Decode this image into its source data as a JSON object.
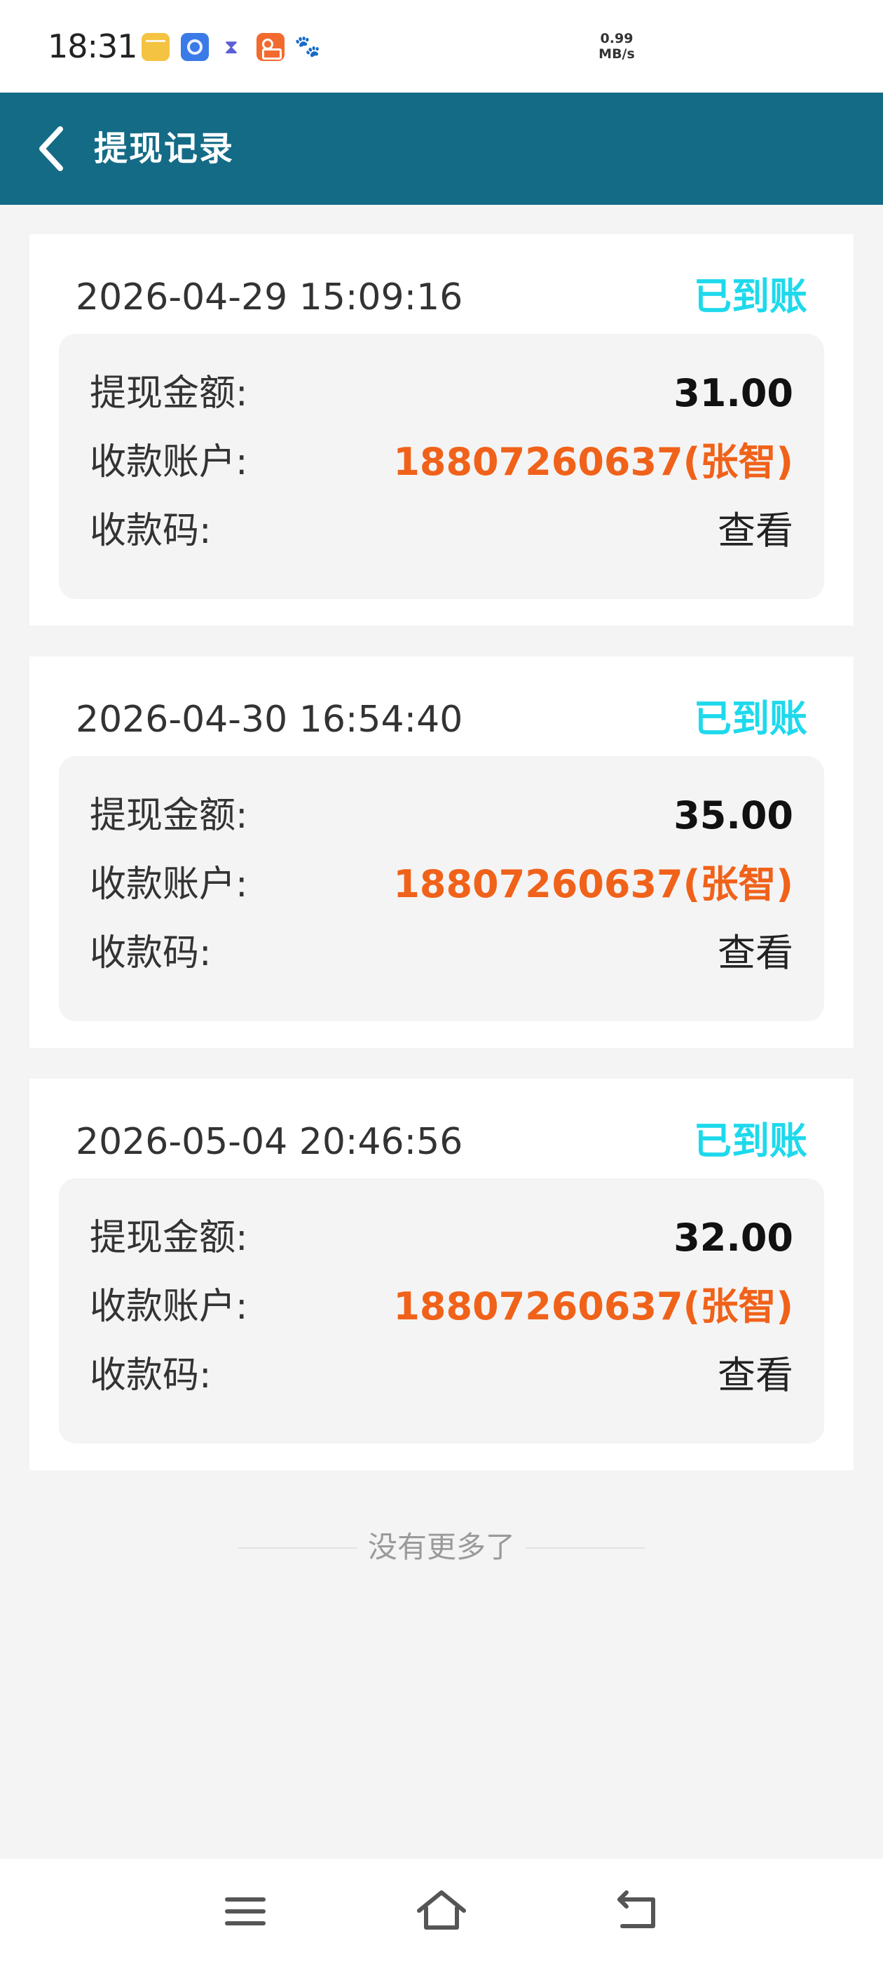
{
  "status_bar": {
    "time": "18:31",
    "network_speed_value": "0.99",
    "network_speed_unit": "MB/s",
    "icons": [
      "notes-icon",
      "browser-icon",
      "hourglass-icon",
      "kuaishou-icon",
      "baidu-icon"
    ]
  },
  "nav": {
    "title": "提现记录",
    "back_icon": "chevron-left-icon"
  },
  "records": [
    {
      "time": "2026-04-29 15:09:16",
      "status": "已到账",
      "amount_label": "提现金额:",
      "amount": "31.00",
      "account_label": "收款账户:",
      "account": "18807260637(张智)",
      "code_label": "收款码:",
      "code_action": "查看"
    },
    {
      "time": "2026-04-30 16:54:40",
      "status": "已到账",
      "amount_label": "提现金额:",
      "amount": "35.00",
      "account_label": "收款账户:",
      "account": "18807260637(张智)",
      "code_label": "收款码:",
      "code_action": "查看"
    },
    {
      "time": "2026-05-04 20:46:56",
      "status": "已到账",
      "amount_label": "提现金额:",
      "amount": "32.00",
      "account_label": "收款账户:",
      "account": "18807260637(张智)",
      "code_label": "收款码:",
      "code_action": "查看"
    }
  ],
  "list_end_text": "没有更多了",
  "colors": {
    "header_bg": "#146b86",
    "status_arrived": "#1ed9ec",
    "account_text": "#f0621a",
    "page_bg": "#f4f4f4"
  },
  "system_nav": {
    "icons": [
      "menu-icon",
      "home-icon",
      "back-icon"
    ]
  }
}
